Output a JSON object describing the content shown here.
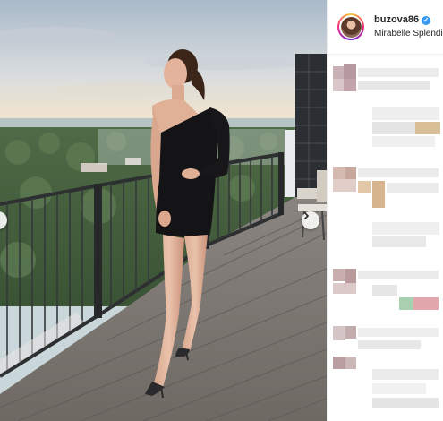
{
  "post": {
    "username": "buzova86",
    "location": "Mirabelle Splendid",
    "verified_icon": "verified-badge-icon",
    "next_icon": "chevron-right-icon",
    "accent_color": "#3897f0"
  }
}
